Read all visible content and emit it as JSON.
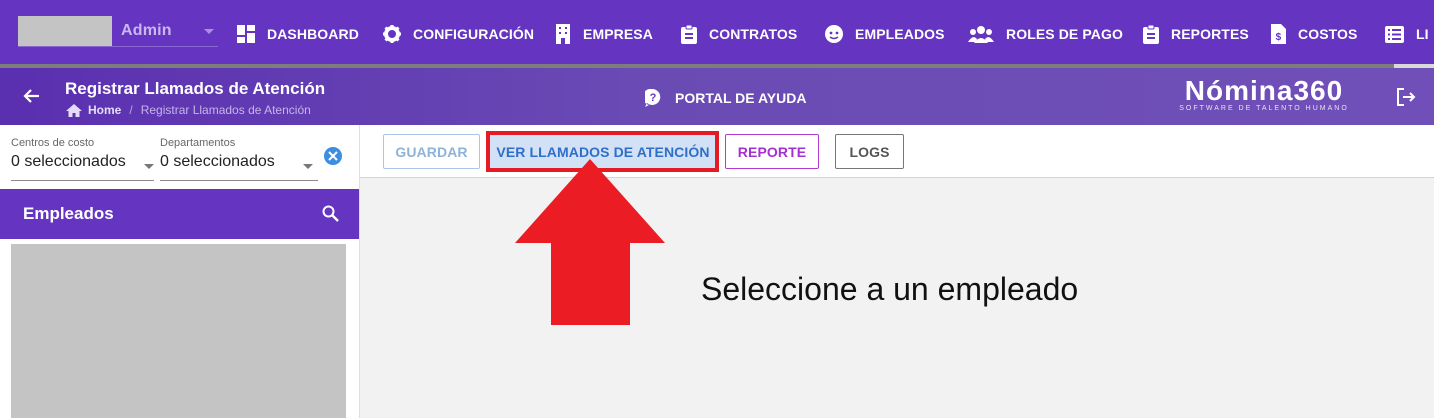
{
  "user": {
    "name": "Admin"
  },
  "nav": {
    "items": [
      {
        "label": "DASHBOARD",
        "icon": "dashboard-icon"
      },
      {
        "label": "CONFIGURACIÓN",
        "icon": "gear-icon"
      },
      {
        "label": "EMPRESA",
        "icon": "building-icon"
      },
      {
        "label": "CONTRATOS",
        "icon": "clipboard-icon"
      },
      {
        "label": "EMPLEADOS",
        "icon": "face-icon"
      },
      {
        "label": "ROLES DE PAGO",
        "icon": "users-icon"
      },
      {
        "label": "REPORTES",
        "icon": "clipboard-icon"
      },
      {
        "label": "COSTOS",
        "icon": "file-dollar-icon"
      },
      {
        "label": "LI",
        "icon": "list-icon"
      }
    ]
  },
  "header": {
    "title": "Registrar Llamados de Atención",
    "breadcrumb": {
      "home": "Home",
      "current": "Registrar Llamados de Atención"
    },
    "help_label": "PORTAL DE AYUDA",
    "brand_name": "Nómina360",
    "brand_tagline": "SOFTWARE DE TALENTO HUMANO"
  },
  "filters": {
    "cost_centers": {
      "label": "Centros de costo",
      "value": "0 seleccionados"
    },
    "departments": {
      "label": "Departamentos",
      "value": "0 seleccionados"
    }
  },
  "employees": {
    "title": "Empleados"
  },
  "toolbar": {
    "save_label": "GUARDAR",
    "view_calls_label": "VER LLAMADOS DE ATENCIÓN",
    "report_label": "REPORTE",
    "logs_label": "LOGS"
  },
  "main": {
    "empty_message": "Seleccione a un empleado"
  },
  "colors": {
    "primary": "#6535c1",
    "annotation_red": "#e41b25",
    "link_blue": "#2f6fc9",
    "report_purple": "#a52fd0"
  }
}
